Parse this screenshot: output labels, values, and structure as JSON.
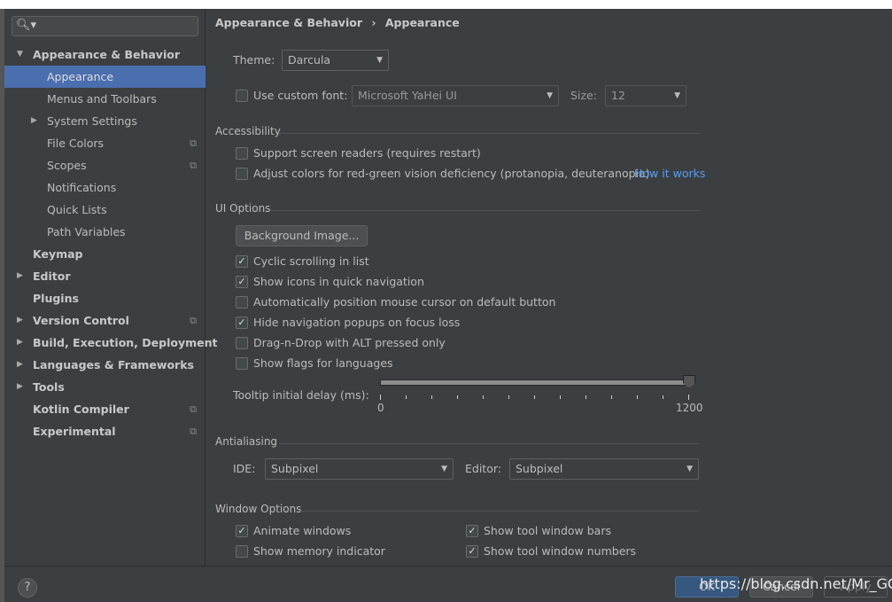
{
  "sidebar": {
    "items": [
      {
        "label": "Appearance & Behavior",
        "level": 0,
        "bold": true,
        "arrow": "expanded"
      },
      {
        "label": "Appearance",
        "level": 1,
        "selected": true
      },
      {
        "label": "Menus and Toolbars",
        "level": 1
      },
      {
        "label": "System Settings",
        "level": 1,
        "arrow": "collapsed"
      },
      {
        "label": "File Colors",
        "level": 1,
        "copy": true
      },
      {
        "label": "Scopes",
        "level": 1,
        "copy": true
      },
      {
        "label": "Notifications",
        "level": 1
      },
      {
        "label": "Quick Lists",
        "level": 1
      },
      {
        "label": "Path Variables",
        "level": 1
      },
      {
        "label": "Keymap",
        "level": 0,
        "bold": true
      },
      {
        "label": "Editor",
        "level": 0,
        "bold": true,
        "arrow": "collapsed"
      },
      {
        "label": "Plugins",
        "level": 0,
        "bold": true
      },
      {
        "label": "Version Control",
        "level": 0,
        "bold": true,
        "arrow": "collapsed",
        "copy": true
      },
      {
        "label": "Build, Execution, Deployment",
        "level": 0,
        "bold": true,
        "arrow": "collapsed"
      },
      {
        "label": "Languages & Frameworks",
        "level": 0,
        "bold": true,
        "arrow": "collapsed"
      },
      {
        "label": "Tools",
        "level": 0,
        "bold": true,
        "arrow": "collapsed"
      },
      {
        "label": "Kotlin Compiler",
        "level": 0,
        "bold": true,
        "copy": true
      },
      {
        "label": "Experimental",
        "level": 0,
        "bold": true,
        "copy": true
      }
    ]
  },
  "breadcrumb": {
    "parent": "Appearance & Behavior",
    "sep": "›",
    "current": "Appearance"
  },
  "theme": {
    "label": "Theme:",
    "value": "Darcula"
  },
  "font": {
    "label": "Use custom font:",
    "checked": false,
    "value": "Microsoft YaHei UI",
    "size_label": "Size:",
    "size": "12"
  },
  "accessibility": {
    "title": "Accessibility",
    "screen_readers": "Support screen readers (requires restart)",
    "color_adjust": "Adjust colors for red-green vision deficiency (protanopia, deuteranopia)",
    "how_it_works": "How it works"
  },
  "ui_options": {
    "title": "UI Options",
    "background_button": "Background Image...",
    "checks": [
      {
        "label": "Cyclic scrolling in list",
        "checked": true
      },
      {
        "label": "Show icons in quick navigation",
        "checked": true
      },
      {
        "label": "Automatically position mouse cursor on default button",
        "checked": false
      },
      {
        "label": "Hide navigation popups on focus loss",
        "checked": true
      },
      {
        "label": "Drag-n-Drop with ALT pressed only",
        "checked": false
      },
      {
        "label": "Show flags for languages",
        "checked": false
      }
    ],
    "tooltip_label": "Tooltip initial delay (ms):",
    "tooltip_min": "0",
    "tooltip_max": "1200",
    "tooltip_value": 1200
  },
  "antialiasing": {
    "title": "Antialiasing",
    "ide_label": "IDE:",
    "ide_value": "Subpixel",
    "editor_label": "Editor:",
    "editor_value": "Subpixel"
  },
  "window_options": {
    "title": "Window Options",
    "checks": [
      {
        "label": "Animate windows",
        "checked": true
      },
      {
        "label": "Show tool window bars",
        "checked": true
      },
      {
        "label": "Show memory indicator",
        "checked": false
      },
      {
        "label": "Show tool window numbers",
        "checked": true
      }
    ]
  },
  "footer": {
    "help": "?",
    "ok": "OK",
    "cancel": "Cancel",
    "apply": "Apply"
  },
  "watermark": "https://blog.csdn.net/Mr_GCH"
}
